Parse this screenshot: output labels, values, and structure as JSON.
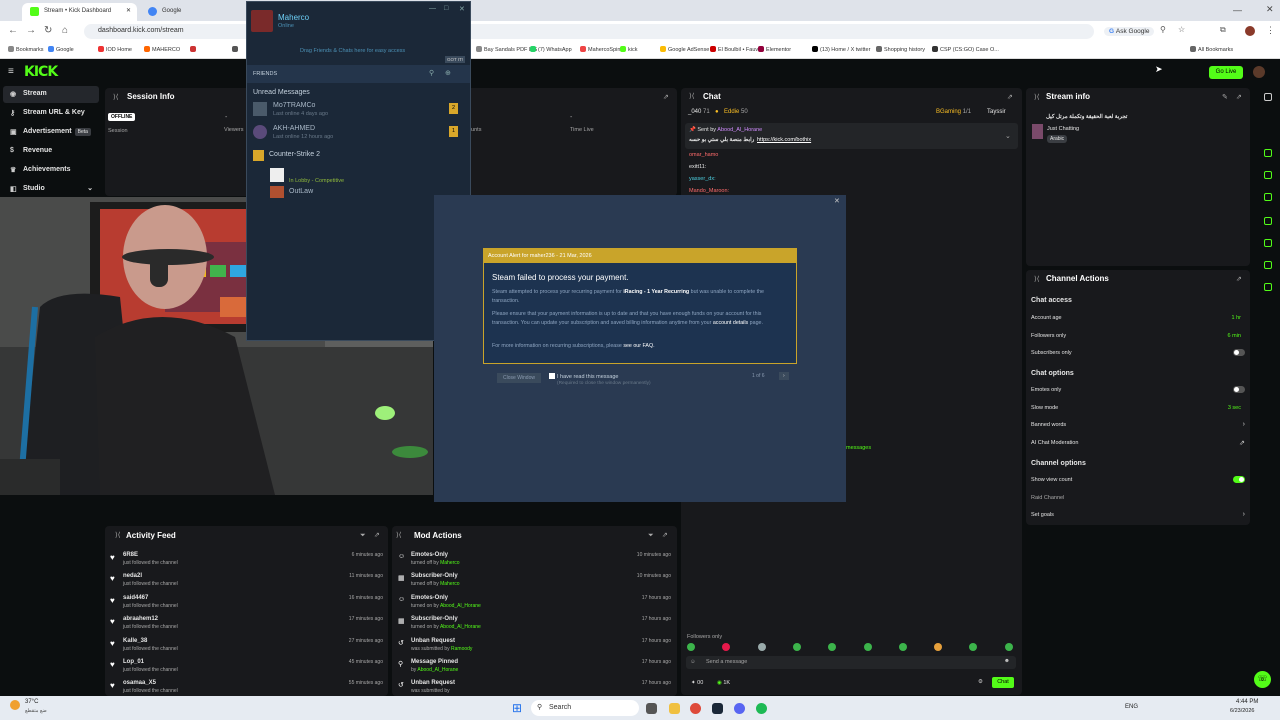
{
  "browser": {
    "tabs": [
      {
        "title": "Stream • Kick Dashboard"
      },
      {
        "title": "Google"
      }
    ],
    "url": "dashboard.kick.com/stream",
    "ask_google": "Ask Google",
    "bookmarks": [
      "Bookmarks",
      "Google",
      "IOD Home",
      "MAHERCO",
      "",
      "",
      "",
      "",
      "Bay Sandals PDF LIS",
      "(7) WhatsApp",
      "MahercoSpin",
      "kick",
      "Google AdSense",
      "El Boulbil • Fauves",
      "Elementor",
      "(13) Home / X twitter",
      "Shopping history",
      "CSP (CS:GO) Case O...",
      "All Bookmarks"
    ]
  },
  "kick": {
    "logo": "KICK",
    "go_live": "Go Live",
    "sidebar": [
      {
        "label": "Stream",
        "icon": "stream-icon"
      },
      {
        "label": "Stream URL & Key",
        "icon": "key-icon"
      },
      {
        "label": "Advertisement",
        "badge": "Beta",
        "icon": "ad-icon"
      },
      {
        "label": "Revenue",
        "icon": "dollar-icon"
      },
      {
        "label": "Achievements",
        "icon": "trophy-icon"
      },
      {
        "label": "Studio",
        "icon": "studio-icon"
      }
    ],
    "session": {
      "title": "Session Info",
      "status": "OFFLINE",
      "labels": [
        "Session",
        "Viewers",
        "ounts",
        "Time Live"
      ],
      "dash": "-"
    },
    "chat": {
      "title": "Chat",
      "top_users": [
        {
          "name": "_040",
          "n": "71"
        },
        {
          "name": "Eddie",
          "n": "50"
        },
        {
          "name": "BGaming",
          "n": "1/1"
        },
        {
          "name": "Tayssir",
          "n": ""
        }
      ],
      "pinned_by": "Sent by",
      "pinned_user": "Abood_Al_Horane",
      "pinned_text": "رابط منصة بلي ستي بو حسه",
      "pinned_link": "https://kick.com/bothix",
      "messages": [
        "omar_hamo",
        "exitt11:",
        "yasser_dx:",
        "Mando_Maroon:"
      ],
      "more": "messages",
      "followers_only": "Followers only",
      "placeholder": "Send a message",
      "send": "Chat",
      "count": "1K",
      "points": "00"
    },
    "stream_info": {
      "title": "Stream info",
      "stream_title": "تجربة لعبة الحقيقة وتكملة مرتل كيل",
      "category": "Just Chatting",
      "tag": "Arabic"
    },
    "channel_actions": {
      "title": "Channel Actions",
      "chat_access": "Chat access",
      "account_age": {
        "label": "Account age",
        "value": "1 hr"
      },
      "followers_only": {
        "label": "Followers only",
        "value": "6 min"
      },
      "subscribers_only": "Subscribers only",
      "chat_options": "Chat options",
      "emotes_only": "Emotes only",
      "slow_mode": {
        "label": "Slow mode",
        "value": "3 sec"
      },
      "banned_words": "Banned words",
      "ai_mod": "AI Chat Moderation",
      "channel_options": "Channel options",
      "show_view": "Show view count",
      "raid": "Raid Channel",
      "goals": "Set goals"
    },
    "activity": {
      "title": "Activity Feed",
      "items": [
        {
          "name": "6R8E",
          "desc": "just followed the channel",
          "time": "6 minutes ago"
        },
        {
          "name": "neda2l",
          "desc": "just followed the channel",
          "time": "11 minutes ago"
        },
        {
          "name": "said4467",
          "desc": "just followed the channel",
          "time": "16 minutes ago"
        },
        {
          "name": "abraahem12",
          "desc": "just followed the channel",
          "time": "17 minutes ago"
        },
        {
          "name": "Kalle_38",
          "desc": "just followed the channel",
          "time": "27 minutes ago"
        },
        {
          "name": "Lop_01",
          "desc": "just followed the channel",
          "time": "45 minutes ago"
        },
        {
          "name": "osamaa_X5",
          "desc": "just followed the channel",
          "time": "55 minutes ago"
        }
      ]
    },
    "mod": {
      "title": "Mod Actions",
      "items": [
        {
          "name": "Emotes-Only",
          "pre": "turned off by",
          "by": "Maherco",
          "time": "10 minutes ago"
        },
        {
          "name": "Subscriber-Only",
          "pre": "turned off by",
          "by": "Maherco",
          "time": "10 minutes ago"
        },
        {
          "name": "Emotes-Only",
          "pre": "turned on by",
          "by": "Abood_Al_Horane",
          "time": "17 hours ago"
        },
        {
          "name": "Subscriber-Only",
          "pre": "turned on by",
          "by": "Abood_Al_Horane",
          "time": "17 hours ago"
        },
        {
          "name": "Unban Request",
          "pre": "was submitted by",
          "by": "Ramoody",
          "time": "17 hours ago"
        },
        {
          "name": "Message Pinned",
          "pre": "by",
          "by": "Abood_Al_Horane",
          "time": "17 hours ago"
        },
        {
          "name": "Unban Request",
          "pre": "was submitted by",
          "by": "",
          "time": "17 hours ago"
        }
      ]
    }
  },
  "steam": {
    "name": "Maherco",
    "status": "Online",
    "drag_hint": "Drag Friends & Chats here for easy access",
    "got_it": "GOT IT!",
    "friends_label": "FRIENDS",
    "unread": "Unread Messages",
    "friends": [
      {
        "name": "Mo7TRAMCo",
        "status": "Last online 4 days ago",
        "count": "2"
      },
      {
        "name": "AKH-AHMED",
        "status": "Last online 12 hours ago",
        "count": "1"
      }
    ],
    "group": "Counter-Strike 2",
    "in_lobby": "In Lobby - Competitive",
    "outlaw": "OutLaw",
    "alert": {
      "header": "Account Alert for maher236 - 21 Mar, 2026",
      "title": "Steam failed to process your payment.",
      "p1a": "Steam attempted to process your recurring payment for",
      "p1b": "iRacing - 1 Year Recurring",
      "p1c": "but was unable to complete the transaction.",
      "p2": "Please ensure that your payment information is up to date and that you have enough funds on your account for this transaction. You can update your subscription and saved billing information anytime from your",
      "p2link": "account details",
      "p2end": "page.",
      "p3": "For more information on recurring subscriptions, please",
      "p3link": "see our FAQ.",
      "close": "Close Window",
      "checkbox": "I have read this message",
      "required": "(Required to close the window permanently)",
      "pager": "1 of 6"
    }
  },
  "taskbar": {
    "weather": "37°C",
    "weather_sub": "ضع متقطع",
    "search": "Search",
    "lang": "ENG",
    "time": "4:44 PM",
    "date": "6/23/2026"
  }
}
